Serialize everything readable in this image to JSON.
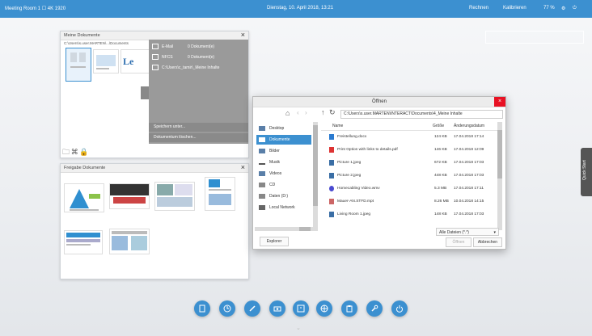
{
  "topbar": {
    "left": "Meeting Room 1  ☐ 4K 1920",
    "center": "Dienstag, 10. April 2018, 13:21",
    "right_a": "Rechnen",
    "right_b": "Kalibrieren",
    "right_c": "77 %",
    "bg_color": "#3c90d0"
  },
  "brand_watermark": "",
  "meine_dokumente": {
    "title": "Meine Dokumente",
    "path": "C:\\Users\\s.user.MARTEN\\...\\Documents",
    "menu": [
      {
        "label": "E-Mail",
        "count": "0 Dokument(e)"
      },
      {
        "label": "NFCS",
        "count": "0 Dokument(e)"
      },
      {
        "label": "C:\\Users\\c_tamir\\_Meine Inhalte",
        "count": ""
      }
    ],
    "menu_bottom": [
      "Speichern unter...",
      "Dokumentum löschen..."
    ]
  },
  "freigabe_dokumente": {
    "title": "Freigabe Dokumente"
  },
  "dialog": {
    "title": "Öffnen",
    "path": "C:\\Users\\s.user.MARTEN\\INTERACT\\Documents\\4_Meine Inhalte",
    "places": [
      "Desktop",
      "Dokumente",
      "Bilder",
      "Musik",
      "Videos",
      "CD",
      "Daten (D:)",
      "Local Network"
    ],
    "selected_place": "Dokumente",
    "columns": [
      "Name",
      "Größe",
      "Änderungsdatum"
    ],
    "files": [
      {
        "name": "Freistellung.docx",
        "size": "124 KB",
        "date": "17.04.2018 17:14",
        "icon": "word-icon"
      },
      {
        "name": "Print Option with links to details.pdf",
        "size": "146 KB",
        "date": "17.04.2018 12:09",
        "icon": "pdf-icon"
      },
      {
        "name": "Picture 1.jpeg",
        "size": "672 KB",
        "date": "17.04.2018 17:03",
        "icon": "image-icon"
      },
      {
        "name": "Picture 2.jpeg",
        "size": "448 KB",
        "date": "17.04.2018 17:03",
        "icon": "image-icon"
      },
      {
        "name": "Homecabling Video.wmv",
        "size": "5.3 MB",
        "date": "17.04.2018 17:11",
        "icon": "video-icon"
      },
      {
        "name": "Mauer-AN.STFD.mpt",
        "size": "8.26 MB",
        "date": "10.04.2018 14:15",
        "icon": "doc-icon"
      },
      {
        "name": "Living Room 1.jpeg",
        "size": "148 KB",
        "date": "17.04.2018 17:03",
        "icon": "image-icon"
      }
    ],
    "filter": "Alle Dateien (*.*)",
    "btn_explorer": "Explorer",
    "btn_open": "Öffnen",
    "btn_cancel": "Abbrechen"
  },
  "side_tab": "Quick Start"
}
